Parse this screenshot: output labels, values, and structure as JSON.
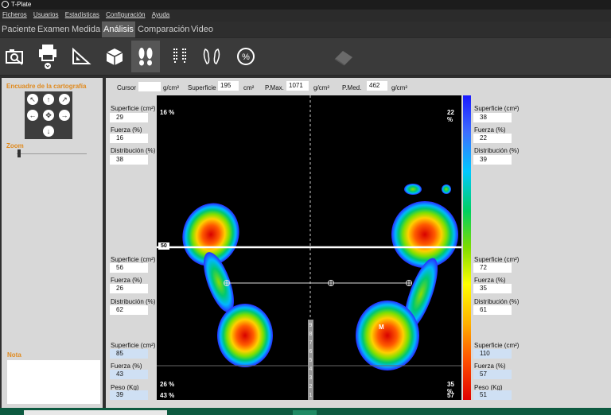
{
  "app": {
    "title": "T-Plate"
  },
  "menu": [
    "Ficheros",
    "Usuarios",
    "Estadísticas",
    "Configuración",
    "Ayuda"
  ],
  "tabs": [
    {
      "label": "Paciente"
    },
    {
      "label": "Examen"
    },
    {
      "label": "Medida"
    },
    {
      "label": "Análisis"
    },
    {
      "label": "Comparación"
    },
    {
      "label": "Video"
    }
  ],
  "toolbar": {
    "icons": [
      "camera-search-icon",
      "print-icon",
      "ruler-triangle-icon",
      "cube-icon",
      "feet-icon",
      "feet-grid-icon",
      "feet-contour-icon",
      "percent-icon",
      "eraser-icon"
    ]
  },
  "left": {
    "encuadre_title": "Encuadre de la cartografía",
    "zoom_label": "Zoom",
    "nota_label": "Nota"
  },
  "cursorbar": {
    "cursor_label": "Cursor",
    "cursor_value": "",
    "cursor_unit": "g/cm²",
    "superficie_label": "Superficie",
    "superficie_value": "195",
    "superficie_unit": "cm²",
    "pmax_label": "P.Max.",
    "pmax_value": "1071",
    "pmax_unit": "g/cm²",
    "pmed_label": "P.Med.",
    "pmed_value": "462",
    "pmed_unit": "g/cm²"
  },
  "left_stats": {
    "top": {
      "superficie_label": "Superficie (cm²)",
      "superficie": "29",
      "fuerza_label": "Fuerza (%)",
      "fuerza": "16",
      "distribucion_label": "Distribución (%)",
      "distribucion": "38"
    },
    "mid": {
      "superficie_label": "Superficie (cm²)",
      "superficie": "56",
      "fuerza_label": "Fuerza (%)",
      "fuerza": "26",
      "distribucion_label": "Distribución (%)",
      "distribucion": "62"
    },
    "total": {
      "superficie_label": "Superficie (cm²)",
      "superficie": "85",
      "fuerza_label": "Fuerza (%)",
      "fuerza": "43",
      "peso_label": "Peso (Kg)",
      "peso": "39"
    }
  },
  "right_stats": {
    "top": {
      "superficie_label": "Superficie (cm²)",
      "superficie": "38",
      "fuerza_label": "Fuerza (%)",
      "fuerza": "22",
      "distribucion_label": "Distribución (%)",
      "distribucion": "39"
    },
    "mid": {
      "superficie_label": "Superficie (cm²)",
      "superficie": "72",
      "fuerza_label": "Fuerza (%)",
      "fuerza": "35",
      "distribucion_label": "Distribución (%)",
      "distribucion": "61"
    },
    "total": {
      "superficie_label": "Superficie (cm²)",
      "superficie": "110",
      "fuerza_label": "Fuerza (%)",
      "fuerza": "57",
      "peso_label": "Peso (Kg)",
      "peso": "51"
    }
  },
  "map": {
    "pct_top_left": "16 %",
    "pct_top_right": "22 %",
    "pct_mid_left": "26 %",
    "pct_mid_right": "35 %",
    "pct_bot_left": "43 %",
    "pct_bot_right": "57 %",
    "divider_label": "50",
    "max_marker": "M",
    "scale_digits": [
      "9",
      "8",
      "7",
      "6",
      "5",
      "4",
      "3",
      "2",
      "1"
    ]
  },
  "colors": {
    "accent_orange": "#e08a1e",
    "footer_green": "#0d5a40"
  }
}
